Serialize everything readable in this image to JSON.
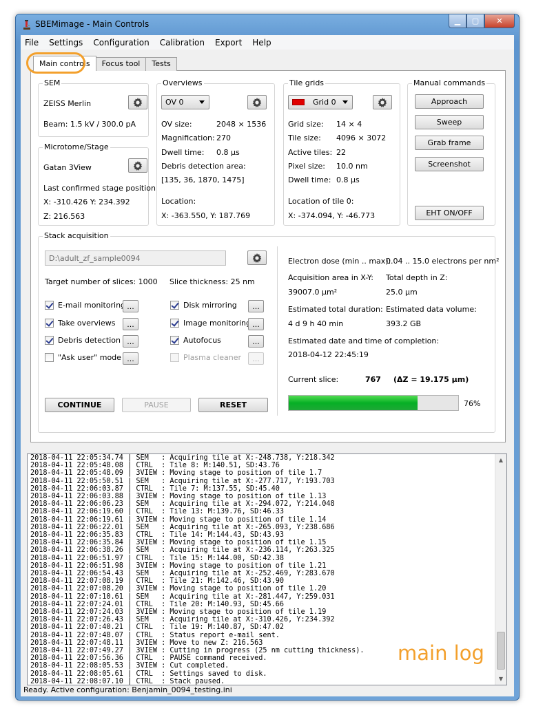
{
  "window": {
    "title": "SBEMimage - Main Controls"
  },
  "menu": [
    "File",
    "Settings",
    "Configuration",
    "Calibration",
    "Export",
    "Help"
  ],
  "tabs": [
    "Main controls",
    "Focus tool",
    "Tests"
  ],
  "sem": {
    "title": "SEM",
    "name": "ZEISS Merlin",
    "beam": "Beam:   1.5 kV / 300.0 pA"
  },
  "microtome": {
    "title": "Microtome/Stage",
    "name": "Gatan 3View",
    "last_pos_label": "Last confirmed stage position:",
    "xy": "X:  -310.426    Y:  234.392",
    "z": "Z:  216.563"
  },
  "overviews": {
    "title": "Overviews",
    "selected": "OV 0",
    "size_label": "OV size:",
    "size": "2048 × 1536",
    "mag_label": "Magnification:",
    "mag": "270",
    "dwell_label": "Dwell time:",
    "dwell": "0.8 µs",
    "debris_label": "Debris detection area:",
    "debris": "[135, 36, 1870, 1475]",
    "location_label": "Location:",
    "location": "X:  -363.550,  Y:  187.769"
  },
  "tilegrids": {
    "title": "Tile grids",
    "selected": "Grid 0",
    "grid_color": "#e00000",
    "grid_size_label": "Grid size:",
    "grid_size": "14 × 4",
    "tile_size_label": "Tile size:",
    "tile_size": "4096 × 3072",
    "active_label": "Active tiles:",
    "active": "22",
    "pixel_label": "Pixel size:",
    "pixel": "10.0 nm",
    "dwell_label": "Dwell time:",
    "dwell": "0.8 µs",
    "location_label": "Location of tile 0:",
    "location": "X:  -374.094,  Y:  -46.773"
  },
  "manual": {
    "title": "Manual commands",
    "approach": "Approach",
    "sweep": "Sweep",
    "grab": "Grab frame",
    "screenshot": "Screenshot",
    "eht": "EHT ON/OFF"
  },
  "stack": {
    "title": "Stack acquisition",
    "path": "D:\\adult_zf_sample0094",
    "target_slices": "Target number of slices:   1000",
    "slice_thickness": "Slice thickness:   25 nm",
    "checks": {
      "email": "E-mail monitoring",
      "overviews": "Take overviews",
      "debris": "Debris detection",
      "askuser": "\"Ask user\" mode",
      "mirroring": "Disk mirroring",
      "imagemon": "Image monitoring",
      "autofocus": "Autofocus",
      "plasma": "Plasma cleaner"
    },
    "dots": "...",
    "continue": "CONTINUE",
    "pause": "PAUSE",
    "reset": "RESET",
    "dose_label": "Electron dose (min .. max):",
    "dose": "0.04 ..  15.0 electrons per nm²",
    "area_label": "Acquisition area in X-Y:",
    "area": "39007.0 µm²",
    "depth_label": "Total depth in Z:",
    "depth": "25.0 µm",
    "duration_label": "Estimated total duration:",
    "duration": "4 d 9 h 40 min",
    "volume_label": "Estimated data volume:",
    "volume": "393.2 GB",
    "completion_label": "Estimated date and time of completion:",
    "completion": "2018-04-12 22:45:19",
    "current_label": "Current slice:",
    "current": "767",
    "dz": "(ΔZ = 19.175 µm)",
    "progress_fraction": 0.76,
    "progress_text": "76%"
  },
  "log": [
    "2018-04-11 22:05:34.74 | SEM   : Acquiring tile at X:-248.738, Y:218.342",
    "2018-04-11 22:05:48.08 | CTRL  : Tile 8: M:140.51, SD:43.76",
    "2018-04-11 22:05:48.09 | 3VIEW : Moving stage to position of tile 1.7",
    "2018-04-11 22:05:50.51 | SEM   : Acquiring tile at X:-277.717, Y:193.703",
    "2018-04-11 22:06:03.87 | CTRL  : Tile 7: M:137.55, SD:45.40",
    "2018-04-11 22:06:03.88 | 3VIEW : Moving stage to position of tile 1.13",
    "2018-04-11 22:06:06.23 | SEM   : Acquiring tile at X:-294.072, Y:214.048",
    "2018-04-11 22:06:19.60 | CTRL  : Tile 13: M:139.76, SD:46.33",
    "2018-04-11 22:06:19.61 | 3VIEW : Moving stage to position of tile 1.14",
    "2018-04-11 22:06:22.01 | SEM   : Acquiring tile at X:-265.093, Y:238.686",
    "2018-04-11 22:06:35.83 | CTRL  : Tile 14: M:144.43, SD:43.93",
    "2018-04-11 22:06:35.84 | 3VIEW : Moving stage to position of tile 1.15",
    "2018-04-11 22:06:38.26 | SEM   : Acquiring tile at X:-236.114, Y:263.325",
    "2018-04-11 22:06:51.97 | CTRL  : Tile 15: M:144.00, SD:42.38",
    "2018-04-11 22:06:51.98 | 3VIEW : Moving stage to position of tile 1.21",
    "2018-04-11 22:06:54.43 | SEM   : Acquiring tile at X:-252.469, Y:283.670",
    "2018-04-11 22:07:08.19 | CTRL  : Tile 21: M:142.46, SD:43.90",
    "2018-04-11 22:07:08.20 | 3VIEW : Moving stage to position of tile 1.20",
    "2018-04-11 22:07:10.61 | SEM   : Acquiring tile at X:-281.447, Y:259.031",
    "2018-04-11 22:07:24.01 | CTRL  : Tile 20: M:140.93, SD:45.66",
    "2018-04-11 22:07:24.03 | 3VIEW : Moving stage to position of tile 1.19",
    "2018-04-11 22:07:26.43 | SEM   : Acquiring tile at X:-310.426, Y:234.392",
    "2018-04-11 22:07:40.21 | CTRL  : Tile 19: M:140.87, SD:47.02",
    "2018-04-11 22:07:48.07 | CTRL  : Status report e-mail sent.",
    "2018-04-11 22:07:48.11 | 3VIEW : Move to new Z: 216.563",
    "2018-04-11 22:07:49.27 | 3VIEW : Cutting in progress (25 nm cutting thickness).",
    "2018-04-11 22:07:56.36 | CTRL  : PAUSE command received.",
    "2018-04-11 22:08:05.53 | 3VIEW : Cut completed.",
    "2018-04-11 22:08:05.61 | CTRL  : Settings saved to disk.",
    "2018-04-11 22:08:07.10 | CTRL  : Stack paused."
  ],
  "annotations": {
    "tab_circle_color": "#f3a02c",
    "main_log": "main log"
  },
  "statusbar": "Ready. Active configuration: Benjamin_0094_testing.ini"
}
